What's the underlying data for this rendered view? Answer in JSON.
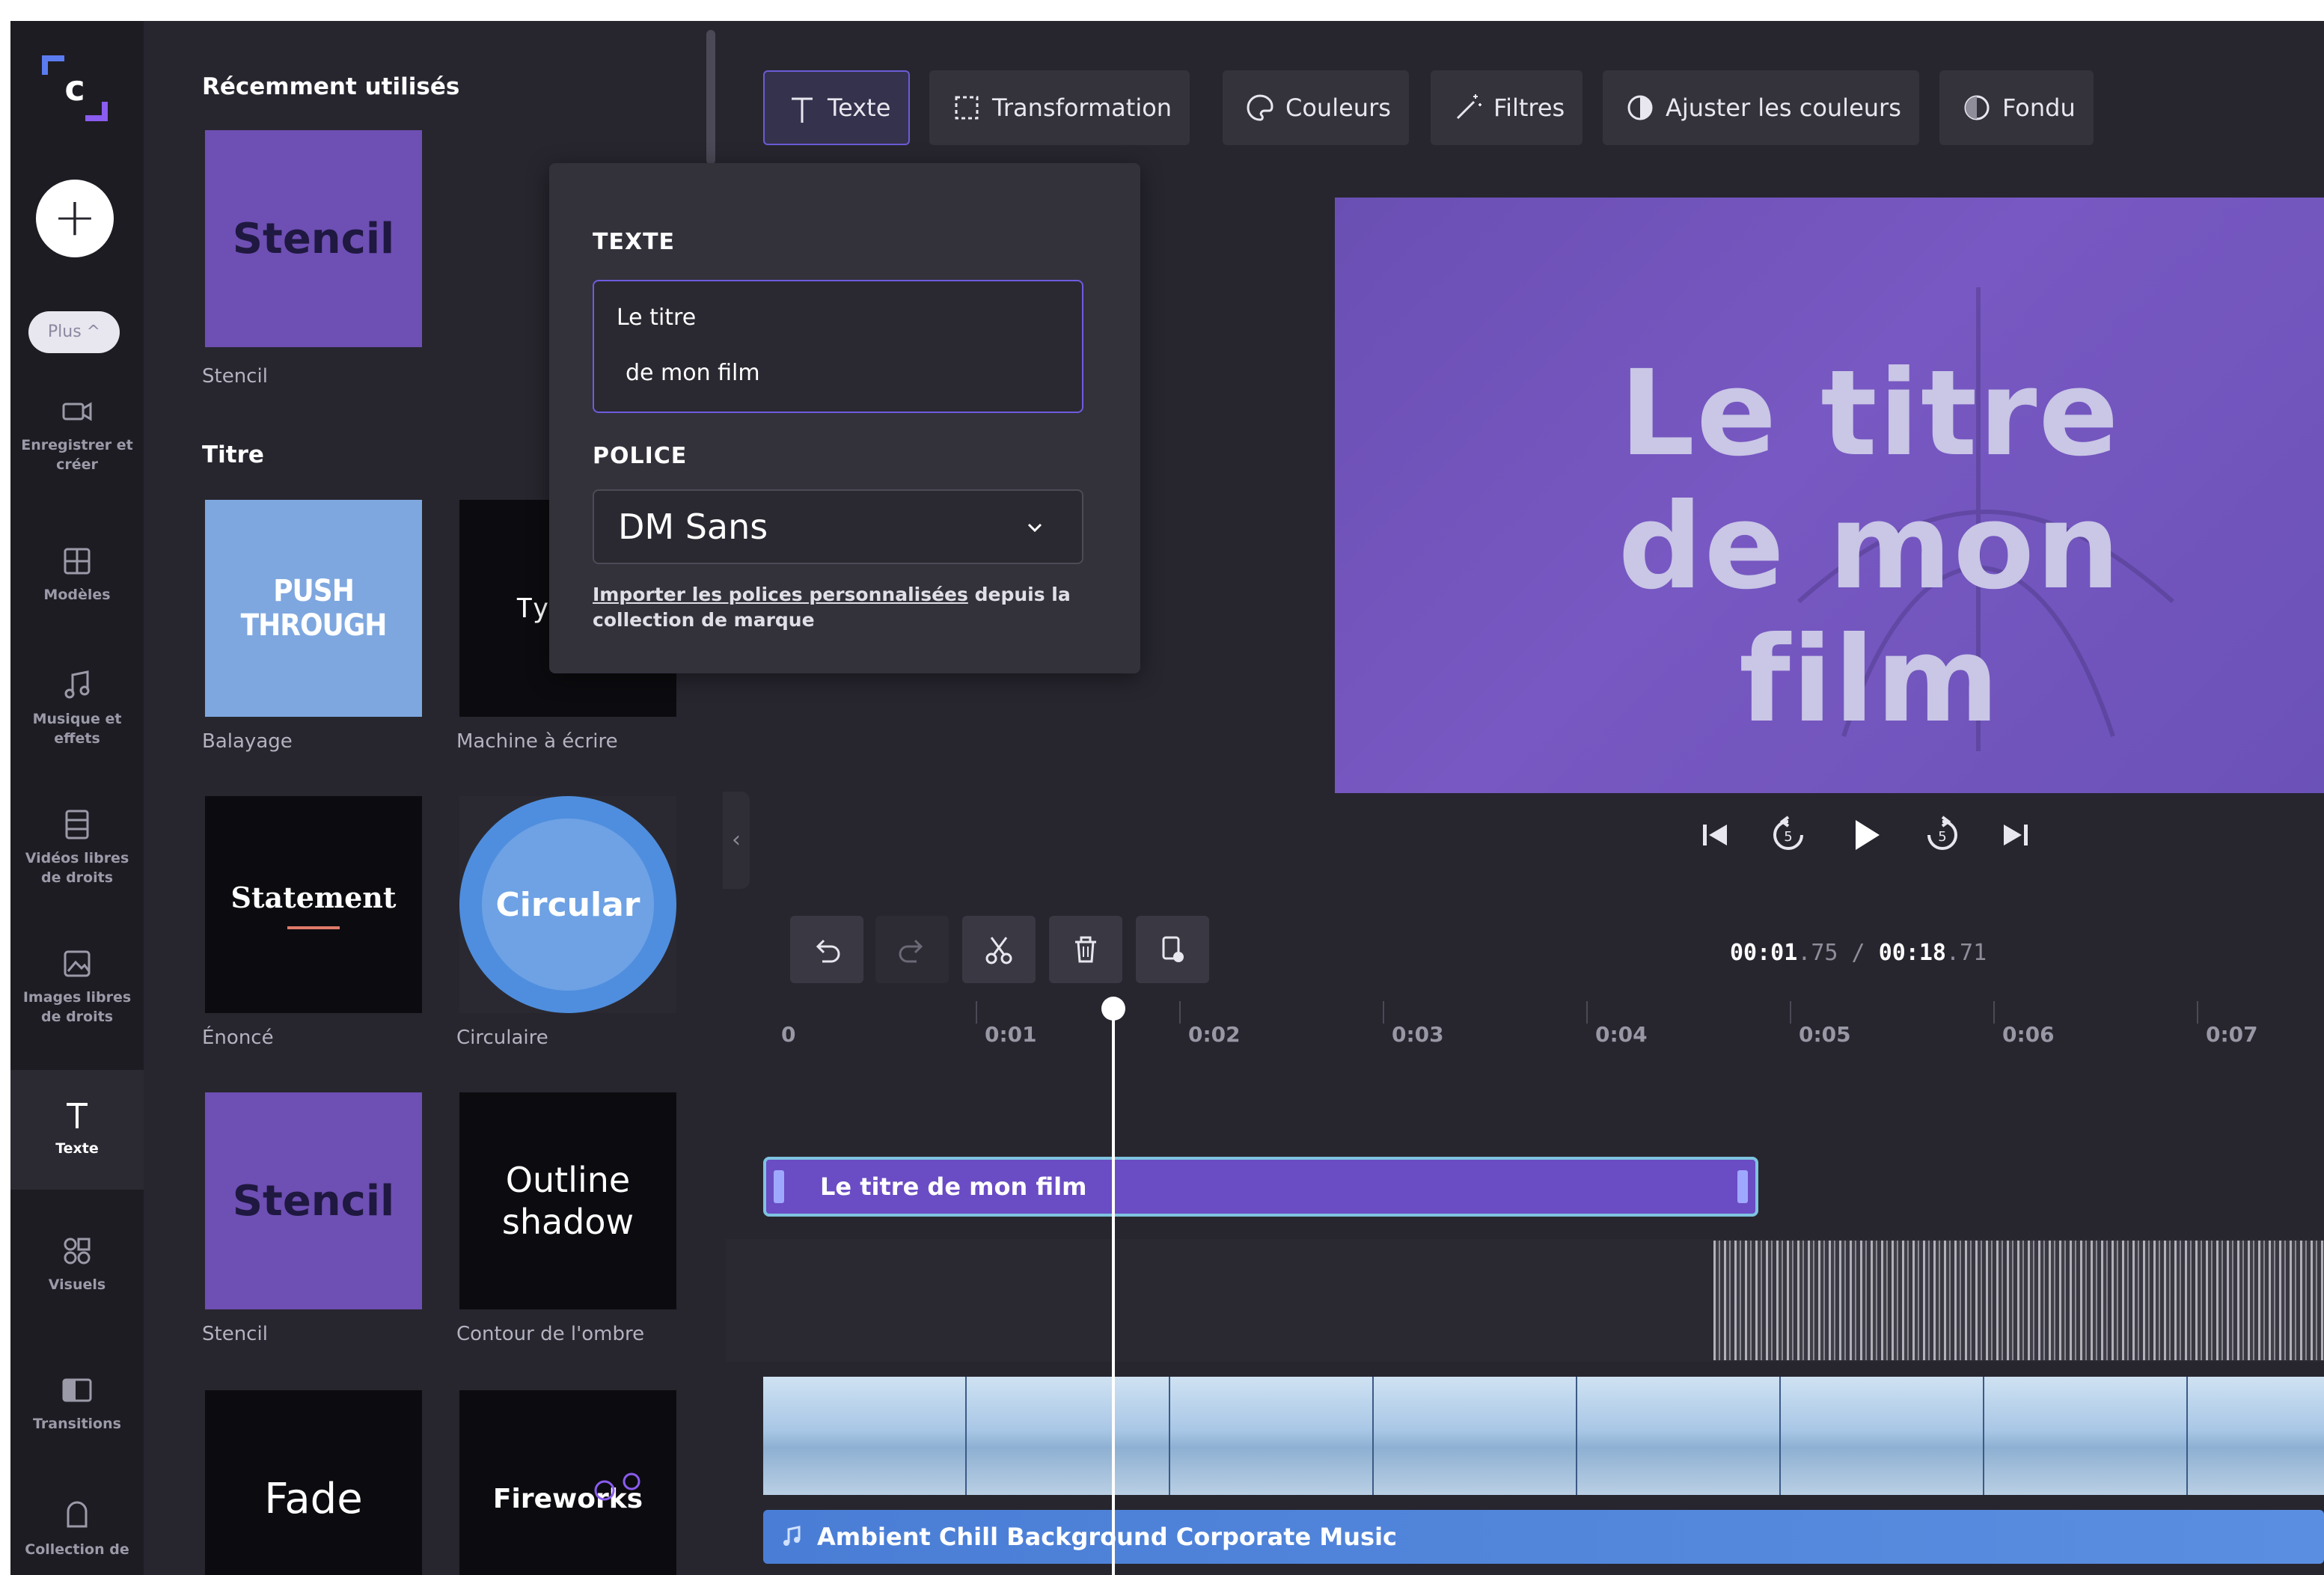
{
  "rail": {
    "items": [
      {
        "label": "Enregistrer et créer",
        "icon": "camera-icon"
      },
      {
        "label": "Modèles",
        "icon": "templates-icon"
      },
      {
        "label": "Musique et effets",
        "icon": "music-icon"
      },
      {
        "label": "Vidéos libres de droits",
        "icon": "film-icon"
      },
      {
        "label": "Images libres de droits",
        "icon": "image-icon"
      },
      {
        "label": "Texte",
        "icon": "text-icon"
      },
      {
        "label": "Visuels",
        "icon": "shapes-icon"
      },
      {
        "label": "Transitions",
        "icon": "transitions-icon"
      },
      {
        "label": "Collection de",
        "icon": "brand-kit-icon"
      }
    ],
    "plus_label": "Plus ^",
    "add_symbol": "+"
  },
  "library": {
    "recent_heading": "Récemment utilisés",
    "title_heading": "Titre",
    "tiles": [
      {
        "text": "Stencil",
        "caption": "Stencil"
      },
      {
        "text": "PUSH THROUGH",
        "caption": "Balayage"
      },
      {
        "text": "Typ",
        "caption": "Machine à écrire"
      },
      {
        "text": "Statement",
        "caption": "Énoncé"
      },
      {
        "text": "Circular",
        "caption": "Circulaire"
      },
      {
        "text": "Stencil",
        "caption": "Stencil"
      },
      {
        "text": "Outline shadow",
        "caption": "Contour de l'ombre"
      },
      {
        "text": "Fade",
        "caption": ""
      },
      {
        "text": "Fireworks",
        "caption": ""
      }
    ]
  },
  "popover": {
    "text_label": "TEXTE",
    "text_line1": "Le titre",
    "text_line2": "de mon film",
    "font_label": "POLICE",
    "font_value": "DM Sans",
    "note_link": "Importer les polices personnalisées",
    "note_rest": " depuis la collection de marque"
  },
  "toolbar": {
    "buttons": [
      {
        "label": "Texte",
        "icon": "text-icon"
      },
      {
        "label": "Transformation",
        "icon": "transform-icon"
      },
      {
        "label": "Couleurs",
        "icon": "palette-icon"
      },
      {
        "label": "Filtres",
        "icon": "magic-wand-icon"
      },
      {
        "label": "Ajuster les couleurs",
        "icon": "contrast-icon"
      },
      {
        "label": "Fondu",
        "icon": "fade-icon"
      }
    ]
  },
  "preview": {
    "title_line1": "Le titre",
    "title_line2": "de mon film"
  },
  "timeline": {
    "current_time": "00:01",
    "current_frac": ".75",
    "separator": " / ",
    "total_time": "00:18",
    "total_frac": ".71",
    "ruler_labels": [
      "0",
      "0:01",
      "0:02",
      "0:03",
      "0:04",
      "0:05",
      "0:06",
      "0:07"
    ],
    "title_clip": "Le titre de mon film",
    "music_clip": "Ambient Chill Background Corporate Music"
  },
  "colors": {
    "accent": "#6a5bd6",
    "stencil_purple": "#6e4fb3",
    "title_clip": "#6a4cc4",
    "music_clip": "#4a7ed6"
  }
}
